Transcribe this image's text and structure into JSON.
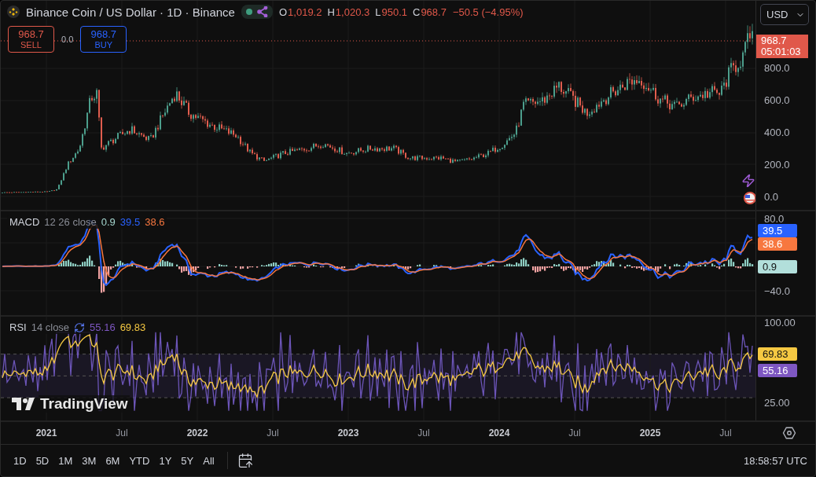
{
  "header": {
    "symbol": "Binance Coin / US Dollar · 1D · Binance",
    "ohlc": [
      {
        "label": "O",
        "value": "1,019.2"
      },
      {
        "label": "H",
        "value": "1,020.3"
      },
      {
        "label": "L",
        "value": "950.1"
      },
      {
        "label": "C",
        "value": "968.7"
      }
    ],
    "change": "−50.5 (−4.95%)"
  },
  "trade": {
    "sell": {
      "price": "968.7",
      "label": "SELL"
    },
    "spread": "0.0",
    "buy": {
      "price": "968.7",
      "label": "BUY"
    }
  },
  "currency": "USD",
  "price_axis": {
    "ticks": [
      "800.0",
      "600.0",
      "400.0",
      "200.0",
      "0.0"
    ],
    "last_price": "968.7",
    "countdown": "05:01:03"
  },
  "macd": {
    "title": "MACD",
    "params": "12 26 close",
    "values": [
      {
        "text": "0.9",
        "color": "#a5d6cf"
      },
      {
        "text": "39.5",
        "color": "#2962ff"
      },
      {
        "text": "38.6",
        "color": "#f7773f"
      }
    ],
    "ticks": [
      "80.0",
      "−40.0"
    ],
    "badges": [
      {
        "text": "39.5",
        "color": "#2962ff"
      },
      {
        "text": "38.6",
        "color": "#f7773f"
      },
      {
        "text": "0.9",
        "color": "#b2dfdb"
      }
    ]
  },
  "rsi": {
    "title": "RSI",
    "params": "14 close",
    "values": [
      {
        "text": "55.16",
        "color": "#7e57c2"
      },
      {
        "text": "69.83",
        "color": "#f5c842"
      }
    ],
    "ticks": [
      "100.00",
      "25.00"
    ],
    "badges": [
      {
        "text": "69.83",
        "color": "#f5c842"
      },
      {
        "text": "55.16",
        "color": "#7e57c2"
      }
    ]
  },
  "watermark": "TradingView",
  "time_axis": [
    {
      "label": "2021",
      "kind": "year"
    },
    {
      "label": "Jul",
      "kind": "month"
    },
    {
      "label": "2022",
      "kind": "year"
    },
    {
      "label": "Jul",
      "kind": "month"
    },
    {
      "label": "2023",
      "kind": "year"
    },
    {
      "label": "Jul",
      "kind": "month"
    },
    {
      "label": "2024",
      "kind": "year"
    },
    {
      "label": "Jul",
      "kind": "month"
    },
    {
      "label": "2025",
      "kind": "year"
    },
    {
      "label": "Jul",
      "kind": "month"
    }
  ],
  "ranges": [
    "1D",
    "5D",
    "1M",
    "3M",
    "6M",
    "YTD",
    "1Y",
    "5Y",
    "All"
  ],
  "clock": "18:58:57 UTC"
}
